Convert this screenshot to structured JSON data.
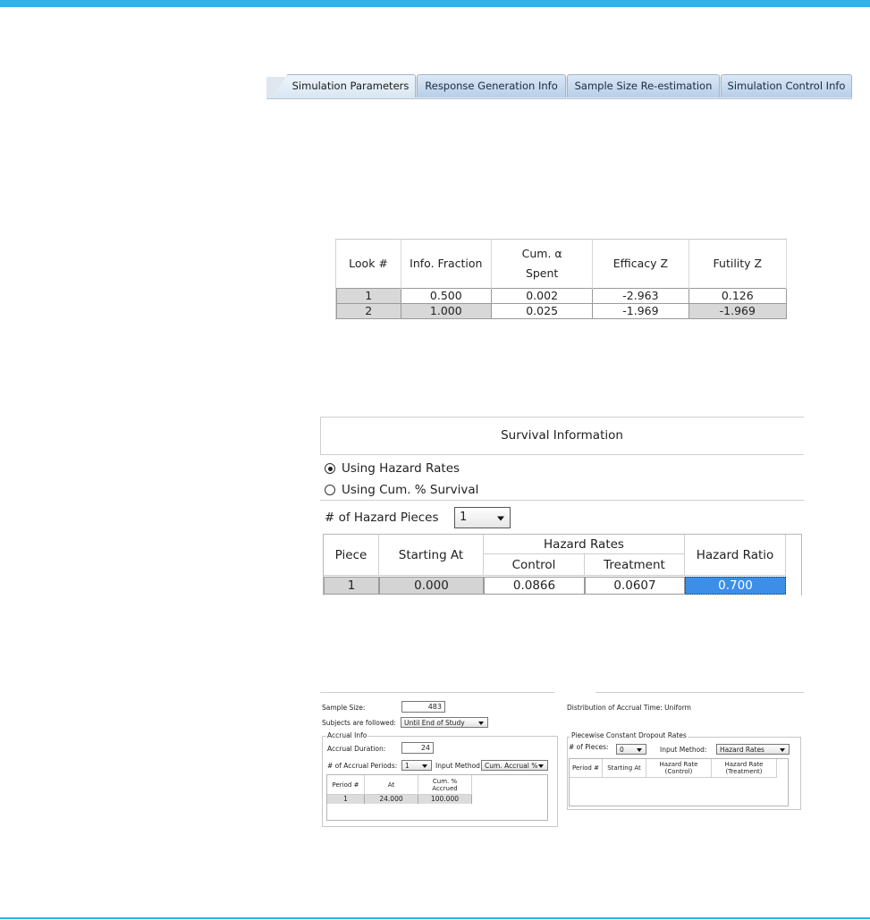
{
  "tabs": [
    {
      "label": "Simulation Parameters",
      "active": true
    },
    {
      "label": "Response Generation Info",
      "active": false
    },
    {
      "label": "Sample Size Re-estimation",
      "active": false
    },
    {
      "label": "Simulation Control Info",
      "active": false
    }
  ],
  "looks_table": {
    "headers": [
      "Look #",
      "Info. Fraction",
      "Cum. α",
      "Spent",
      "Efficacy Z",
      "Futility Z"
    ],
    "rows": [
      [
        "1",
        "0.500",
        "0.002",
        "-2.963",
        "0.126"
      ],
      [
        "2",
        "1.000",
        "0.025",
        "-1.969",
        "-1.969"
      ]
    ]
  },
  "survival": {
    "title": "Survival Information",
    "radio_hazard": "Using Hazard Rates",
    "radio_cum": "Using Cum. % Survival",
    "pieces_label": "# of Hazard Pieces",
    "pieces_value": "1",
    "headers": {
      "piece": "Piece",
      "starting_at": "Starting At",
      "hazard_rates": "Hazard Rates",
      "control": "Control",
      "treatment": "Treatment",
      "hazard_ratio": "Hazard Ratio"
    },
    "row": {
      "piece": "1",
      "starting_at": "0.000",
      "control": "0.0866",
      "treatment": "0.0607",
      "hazard_ratio": "0.700"
    }
  },
  "accrual": {
    "sample_size_label": "Sample Size:",
    "sample_size_value": "483",
    "followed_label": "Subjects are followed:",
    "followed_value": "Until End of Study",
    "accrual_info_title": "Accrual Info",
    "duration_label": "Accrual Duration:",
    "duration_value": "24",
    "periods_label": "# of Accrual Periods:",
    "periods_value": "1",
    "input_method_label": "Input Method",
    "input_method_value": "Cum. Accrual %",
    "grid_headers": [
      "Period #",
      "At",
      "Cum. %",
      "Accrued"
    ],
    "grid_row": [
      "1",
      "24.000",
      "100.000"
    ],
    "distribution_text": "Distribution of Accrual Time: Uniform",
    "dropout_title": "Piecewise Constant Dropout Rates",
    "dropout_pieces_label": "# of Pieces:",
    "dropout_pieces_value": "0",
    "dropout_input_method_label": "Input Method:",
    "dropout_input_method_value": "Hazard Rates",
    "dropout_headers": [
      "Period #",
      "Starting At",
      "Hazard Rate",
      "(Control)",
      "Hazard Rate",
      "(Treatment)"
    ]
  },
  "colors": {
    "accent": "#2fb3ea",
    "selection": "#3d8ee8"
  }
}
